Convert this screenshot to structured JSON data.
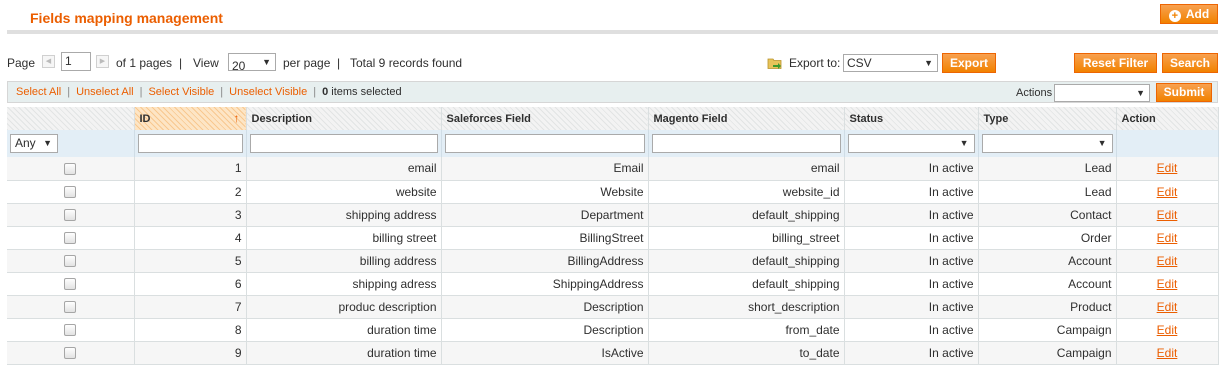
{
  "header": {
    "title": "Fields mapping management",
    "add_label": "Add",
    "add_icon": "plus-circle-icon"
  },
  "pager": {
    "page_label": "Page",
    "page_value": "1",
    "of_pages": "of 1 pages",
    "sep": "|",
    "view_label": "View",
    "view_value": "20",
    "per_page": "per page",
    "total": "Total 9 records found"
  },
  "export": {
    "label": "Export to:",
    "format": "CSV",
    "button": "Export"
  },
  "buttons": {
    "reset": "Reset Filter",
    "search": "Search"
  },
  "massaction": {
    "select_all": "Select All",
    "unselect_all": "Unselect All",
    "select_visible": "Select Visible",
    "unselect_visible": "Unselect Visible",
    "sep": "|",
    "count": "0",
    "selected_text": "items selected",
    "actions_label": "Actions",
    "actions_value": "",
    "submit": "Submit"
  },
  "grid": {
    "columns": [
      "",
      "ID",
      "Description",
      "Saleforces Field",
      "Magento Field",
      "Status",
      "Type",
      "Action"
    ],
    "filter_any": "Any",
    "rows": [
      {
        "id": "1",
        "description": "email",
        "sf": "Email",
        "mg": "email",
        "status": "In active",
        "type": "Lead",
        "action": "Edit"
      },
      {
        "id": "2",
        "description": "website",
        "sf": "Website",
        "mg": "website_id",
        "status": "In active",
        "type": "Lead",
        "action": "Edit"
      },
      {
        "id": "3",
        "description": "shipping address",
        "sf": "Department",
        "mg": "default_shipping",
        "status": "In active",
        "type": "Contact",
        "action": "Edit"
      },
      {
        "id": "4",
        "description": "billing street",
        "sf": "BillingStreet",
        "mg": "billing_street",
        "status": "In active",
        "type": "Order",
        "action": "Edit"
      },
      {
        "id": "5",
        "description": "billing address",
        "sf": "BillingAddress",
        "mg": "default_shipping",
        "status": "In active",
        "type": "Account",
        "action": "Edit"
      },
      {
        "id": "6",
        "description": "shipping adress",
        "sf": "ShippingAddress",
        "mg": "default_shipping",
        "status": "In active",
        "type": "Account",
        "action": "Edit"
      },
      {
        "id": "7",
        "description": "produc description",
        "sf": "Description",
        "mg": "short_description",
        "status": "In active",
        "type": "Product",
        "action": "Edit"
      },
      {
        "id": "8",
        "description": "duration time",
        "sf": "Description",
        "mg": "from_date",
        "status": "In active",
        "type": "Campaign",
        "action": "Edit"
      },
      {
        "id": "9",
        "description": "duration time",
        "sf": "IsActive",
        "mg": "to_date",
        "status": "In active",
        "type": "Campaign",
        "action": "Edit"
      }
    ]
  },
  "colors": {
    "accent": "#eb5e00",
    "button": "#f18200",
    "filter_row": "#e3eef6"
  }
}
